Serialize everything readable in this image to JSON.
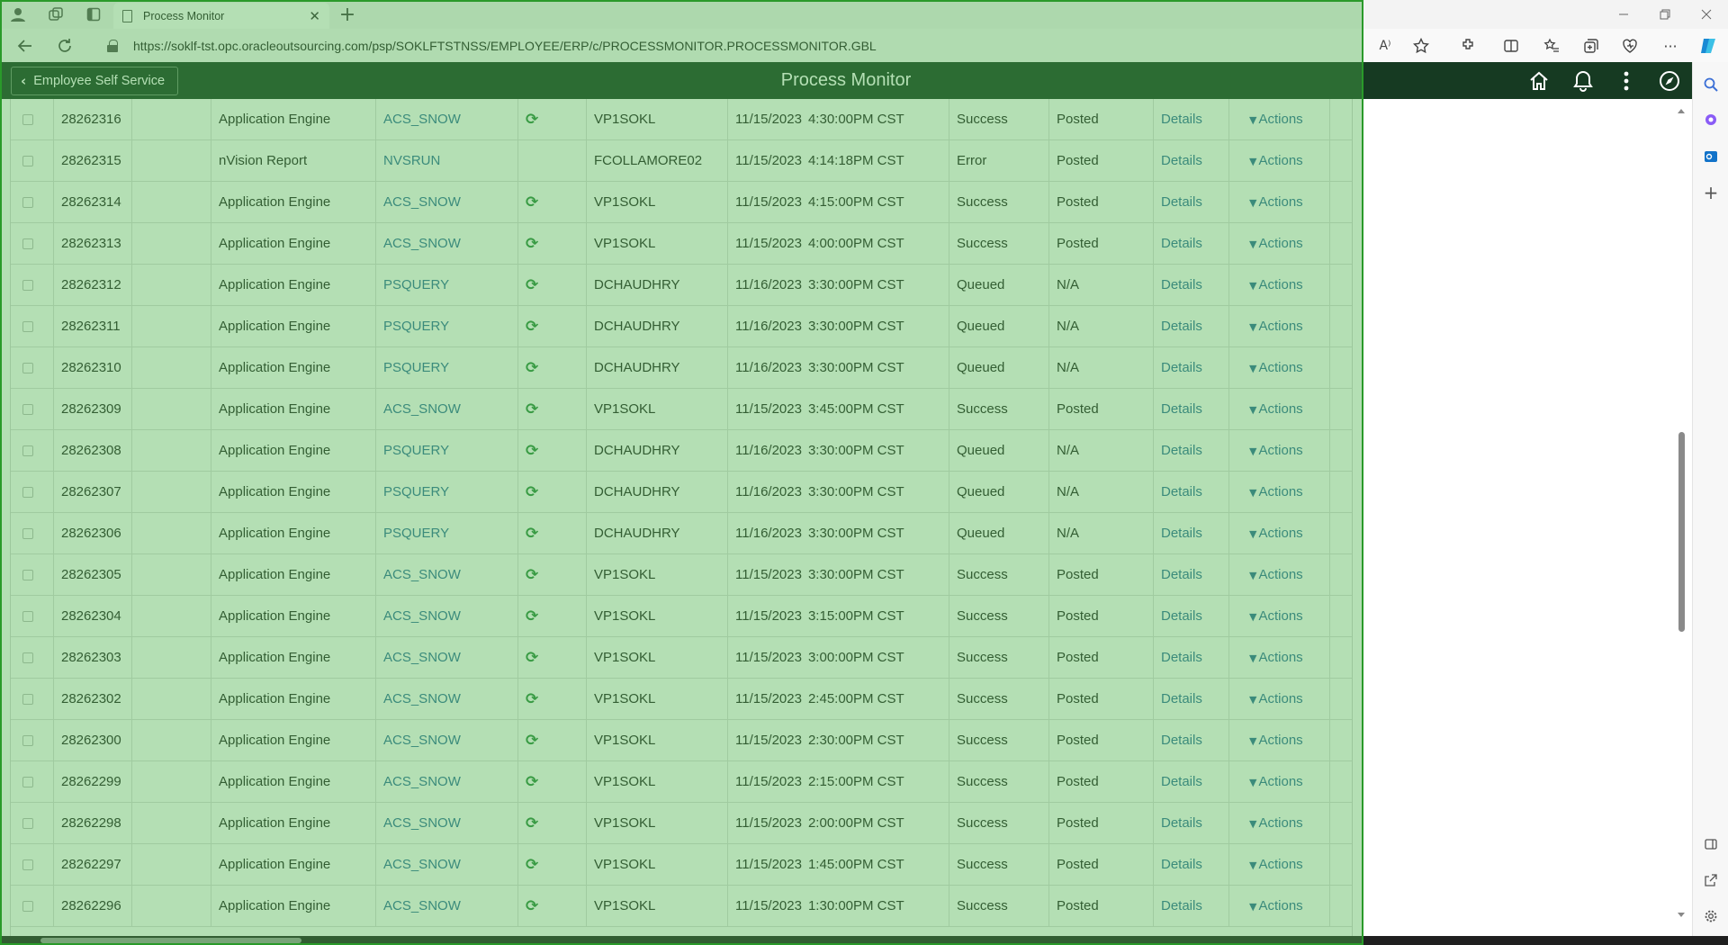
{
  "browser": {
    "tab_title": "Process Monitor",
    "new_tab": "+",
    "close_tab": "✕",
    "url": "https://soklf-tst.opc.oracleoutsourcing.com/psp/SOKLFTSTNSS/EMPLOYEE/ERP/c/PROCESSMONITOR.PROCESSMONITOR.GBL",
    "read_aloud": "A⁾"
  },
  "header": {
    "back_label": "Employee Self Service",
    "page_title": "Process Monitor"
  },
  "link_labels": {
    "details": "Details",
    "actions": "Actions"
  },
  "rows": [
    {
      "id": "28262316",
      "type": "Application Engine",
      "name": "ACS_SNOW",
      "recurring": true,
      "user": "VP1SOKL",
      "date": "11/15/2023",
      "time": "4:30:00PM CST",
      "run_status": "Success",
      "dist_status": "Posted"
    },
    {
      "id": "28262315",
      "type": "nVision Report",
      "name": "NVSRUN",
      "recurring": false,
      "user": "FCOLLAMORE02",
      "date": "11/15/2023",
      "time": "4:14:18PM CST",
      "run_status": "Error",
      "dist_status": "Posted"
    },
    {
      "id": "28262314",
      "type": "Application Engine",
      "name": "ACS_SNOW",
      "recurring": true,
      "user": "VP1SOKL",
      "date": "11/15/2023",
      "time": "4:15:00PM CST",
      "run_status": "Success",
      "dist_status": "Posted"
    },
    {
      "id": "28262313",
      "type": "Application Engine",
      "name": "ACS_SNOW",
      "recurring": true,
      "user": "VP1SOKL",
      "date": "11/15/2023",
      "time": "4:00:00PM CST",
      "run_status": "Success",
      "dist_status": "Posted"
    },
    {
      "id": "28262312",
      "type": "Application Engine",
      "name": "PSQUERY",
      "recurring": true,
      "user": "DCHAUDHRY",
      "date": "11/16/2023",
      "time": "3:30:00PM CST",
      "run_status": "Queued",
      "dist_status": "N/A"
    },
    {
      "id": "28262311",
      "type": "Application Engine",
      "name": "PSQUERY",
      "recurring": true,
      "user": "DCHAUDHRY",
      "date": "11/16/2023",
      "time": "3:30:00PM CST",
      "run_status": "Queued",
      "dist_status": "N/A"
    },
    {
      "id": "28262310",
      "type": "Application Engine",
      "name": "PSQUERY",
      "recurring": true,
      "user": "DCHAUDHRY",
      "date": "11/16/2023",
      "time": "3:30:00PM CST",
      "run_status": "Queued",
      "dist_status": "N/A"
    },
    {
      "id": "28262309",
      "type": "Application Engine",
      "name": "ACS_SNOW",
      "recurring": true,
      "user": "VP1SOKL",
      "date": "11/15/2023",
      "time": "3:45:00PM CST",
      "run_status": "Success",
      "dist_status": "Posted"
    },
    {
      "id": "28262308",
      "type": "Application Engine",
      "name": "PSQUERY",
      "recurring": true,
      "user": "DCHAUDHRY",
      "date": "11/16/2023",
      "time": "3:30:00PM CST",
      "run_status": "Queued",
      "dist_status": "N/A"
    },
    {
      "id": "28262307",
      "type": "Application Engine",
      "name": "PSQUERY",
      "recurring": true,
      "user": "DCHAUDHRY",
      "date": "11/16/2023",
      "time": "3:30:00PM CST",
      "run_status": "Queued",
      "dist_status": "N/A"
    },
    {
      "id": "28262306",
      "type": "Application Engine",
      "name": "PSQUERY",
      "recurring": true,
      "user": "DCHAUDHRY",
      "date": "11/16/2023",
      "time": "3:30:00PM CST",
      "run_status": "Queued",
      "dist_status": "N/A"
    },
    {
      "id": "28262305",
      "type": "Application Engine",
      "name": "ACS_SNOW",
      "recurring": true,
      "user": "VP1SOKL",
      "date": "11/15/2023",
      "time": "3:30:00PM CST",
      "run_status": "Success",
      "dist_status": "Posted"
    },
    {
      "id": "28262304",
      "type": "Application Engine",
      "name": "ACS_SNOW",
      "recurring": true,
      "user": "VP1SOKL",
      "date": "11/15/2023",
      "time": "3:15:00PM CST",
      "run_status": "Success",
      "dist_status": "Posted"
    },
    {
      "id": "28262303",
      "type": "Application Engine",
      "name": "ACS_SNOW",
      "recurring": true,
      "user": "VP1SOKL",
      "date": "11/15/2023",
      "time": "3:00:00PM CST",
      "run_status": "Success",
      "dist_status": "Posted"
    },
    {
      "id": "28262302",
      "type": "Application Engine",
      "name": "ACS_SNOW",
      "recurring": true,
      "user": "VP1SOKL",
      "date": "11/15/2023",
      "time": "2:45:00PM CST",
      "run_status": "Success",
      "dist_status": "Posted"
    },
    {
      "id": "28262300",
      "type": "Application Engine",
      "name": "ACS_SNOW",
      "recurring": true,
      "user": "VP1SOKL",
      "date": "11/15/2023",
      "time": "2:30:00PM CST",
      "run_status": "Success",
      "dist_status": "Posted"
    },
    {
      "id": "28262299",
      "type": "Application Engine",
      "name": "ACS_SNOW",
      "recurring": true,
      "user": "VP1SOKL",
      "date": "11/15/2023",
      "time": "2:15:00PM CST",
      "run_status": "Success",
      "dist_status": "Posted"
    },
    {
      "id": "28262298",
      "type": "Application Engine",
      "name": "ACS_SNOW",
      "recurring": true,
      "user": "VP1SOKL",
      "date": "11/15/2023",
      "time": "2:00:00PM CST",
      "run_status": "Success",
      "dist_status": "Posted"
    },
    {
      "id": "28262297",
      "type": "Application Engine",
      "name": "ACS_SNOW",
      "recurring": true,
      "user": "VP1SOKL",
      "date": "11/15/2023",
      "time": "1:45:00PM CST",
      "run_status": "Success",
      "dist_status": "Posted"
    },
    {
      "id": "28262296",
      "type": "Application Engine",
      "name": "ACS_SNOW",
      "recurring": true,
      "user": "VP1SOKL",
      "date": "11/15/2023",
      "time": "1:30:00PM CST",
      "run_status": "Success",
      "dist_status": "Posted"
    }
  ],
  "colors": {
    "banner": "#163a22",
    "link": "#2f6f9e",
    "recurrence_icon": "#2b8a3e",
    "overlay": "#4cb24c"
  }
}
